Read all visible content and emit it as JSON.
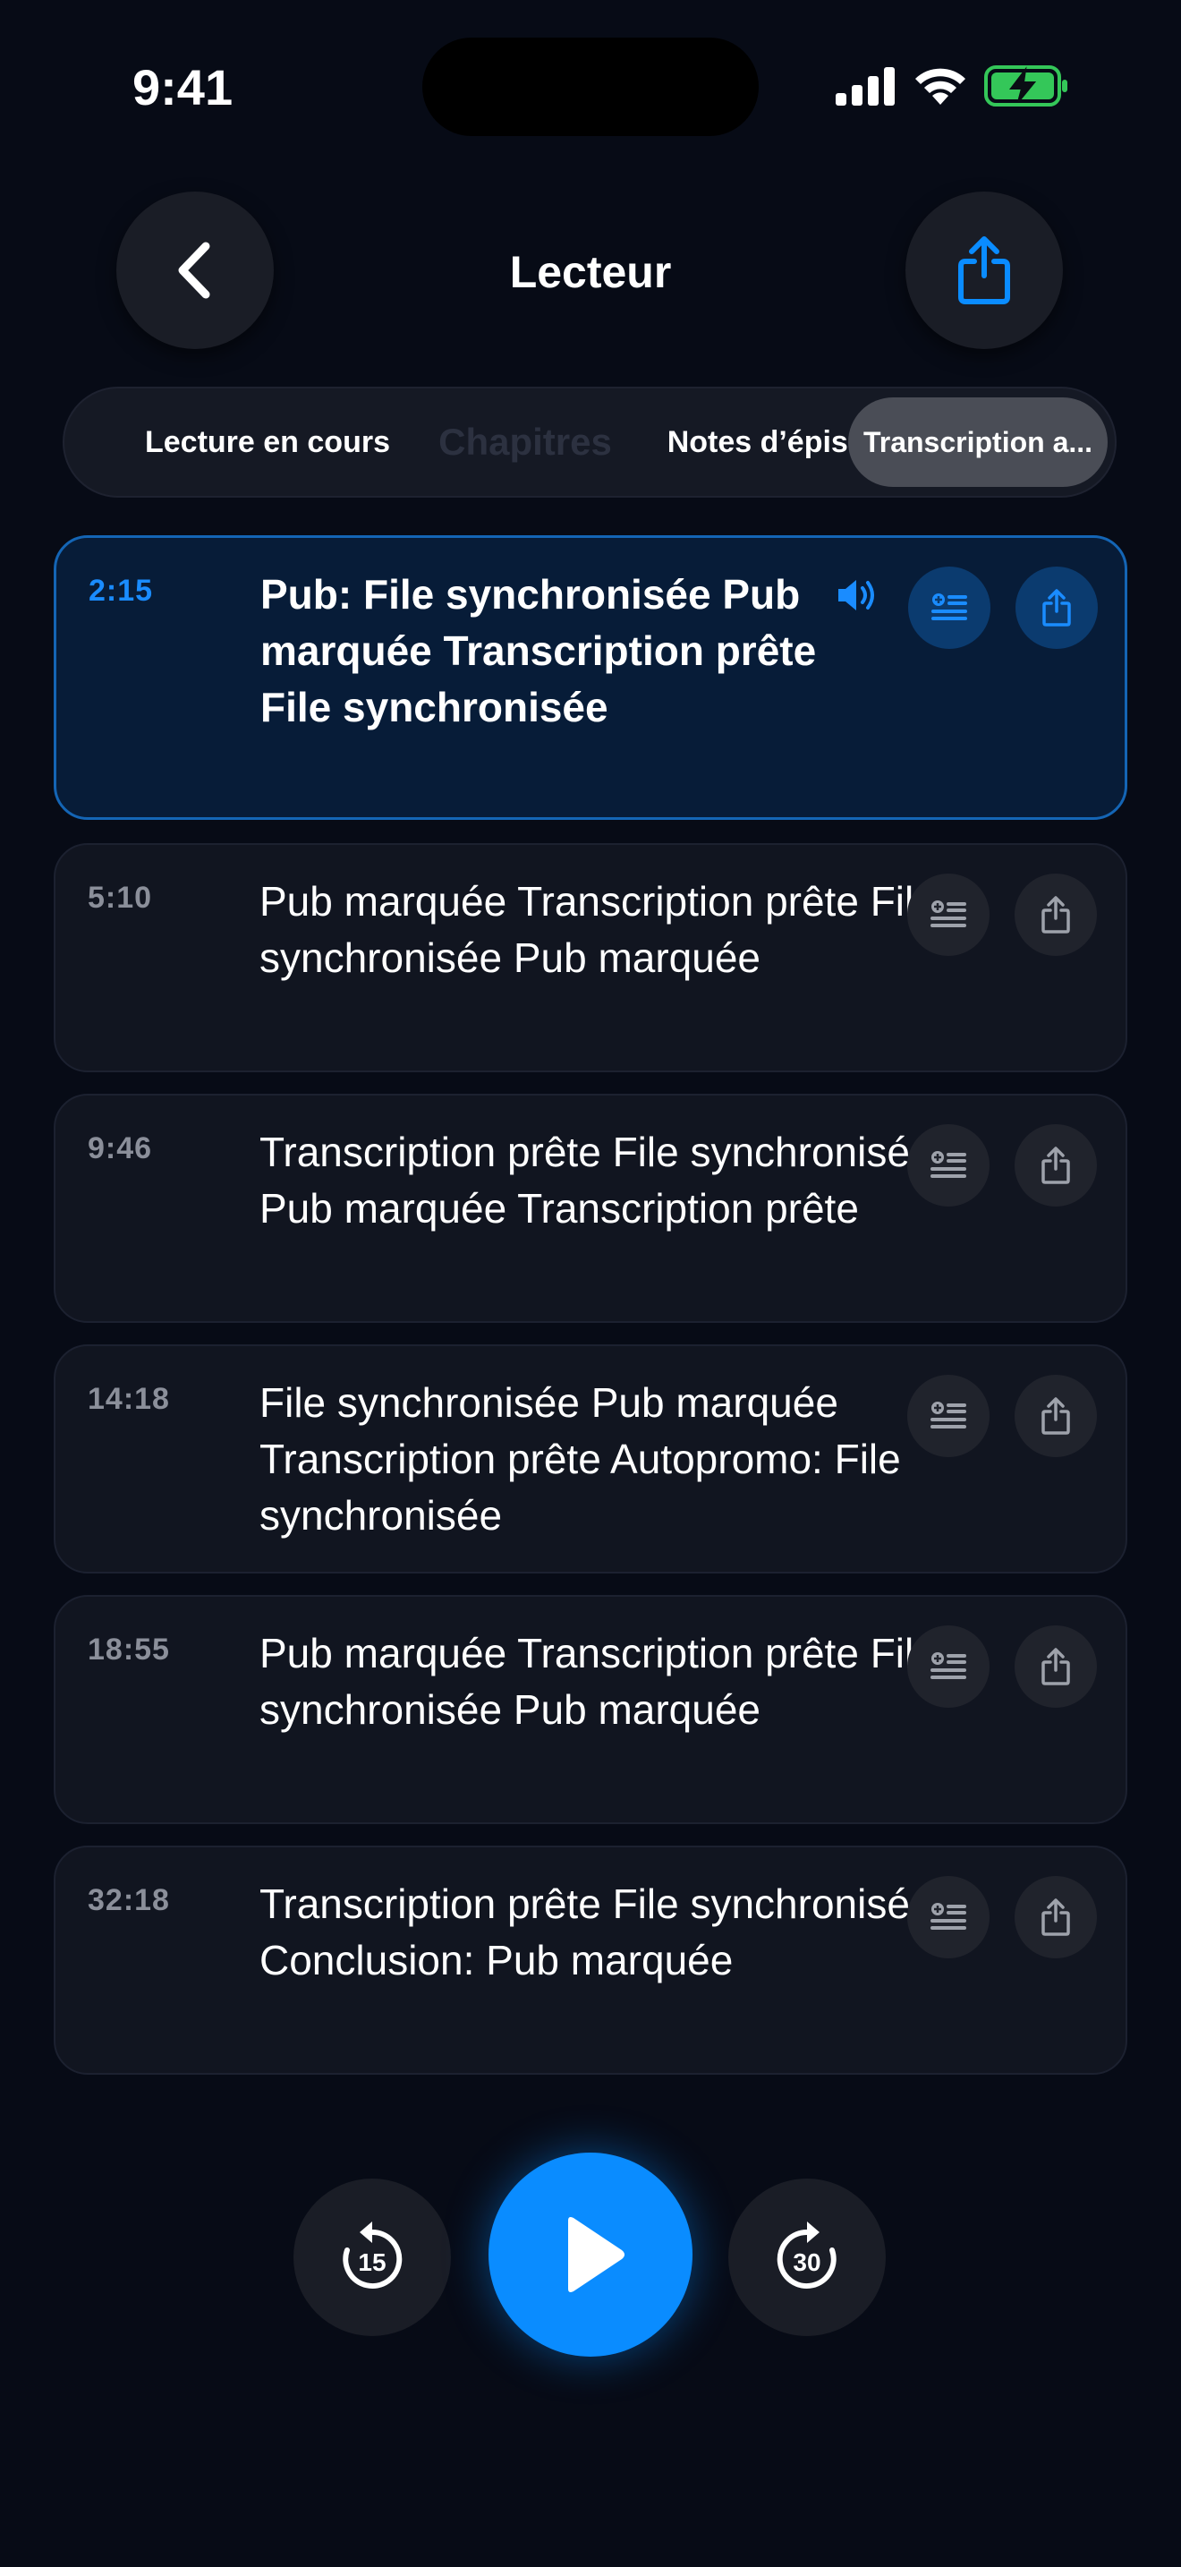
{
  "status_bar": {
    "time": "9:41"
  },
  "header": {
    "title": "Lecteur",
    "back_icon": "chevron-left-icon",
    "share_icon": "share-icon"
  },
  "tabs": [
    {
      "label": "Lecture en cours",
      "active": false
    },
    {
      "label": "Chapitres",
      "active": false
    },
    {
      "label": "Notes d’épisode",
      "active": false
    },
    {
      "label": "Transcription a...",
      "active": true
    }
  ],
  "transcript": [
    {
      "time": "2:15",
      "text": "Pub: File synchronisée Pub marquée Transcription prête File synchronisée",
      "active": true
    },
    {
      "time": "5:10",
      "text": "Pub marquée Transcription prête File synchronisée Pub marquée",
      "active": false
    },
    {
      "time": "9:46",
      "text": "Transcription prête File synchronisée Pub marquée Transcription prête",
      "active": false
    },
    {
      "time": "14:18",
      "text": "File synchronisée Pub marquée Transcription prête Autopromo: File synchronisée",
      "active": false
    },
    {
      "time": "18:55",
      "text": "Pub marquée Transcription prête File synchronisée Pub marquée",
      "active": false
    },
    {
      "time": "32:18",
      "text": "Transcription prête File synchronisée Conclusion: Pub marquée",
      "active": false
    }
  ],
  "player": {
    "skip_back": "15",
    "skip_forward": "30"
  },
  "colors": {
    "accent": "#0a8cff",
    "background": "#070b16",
    "battery": "#34c759"
  }
}
